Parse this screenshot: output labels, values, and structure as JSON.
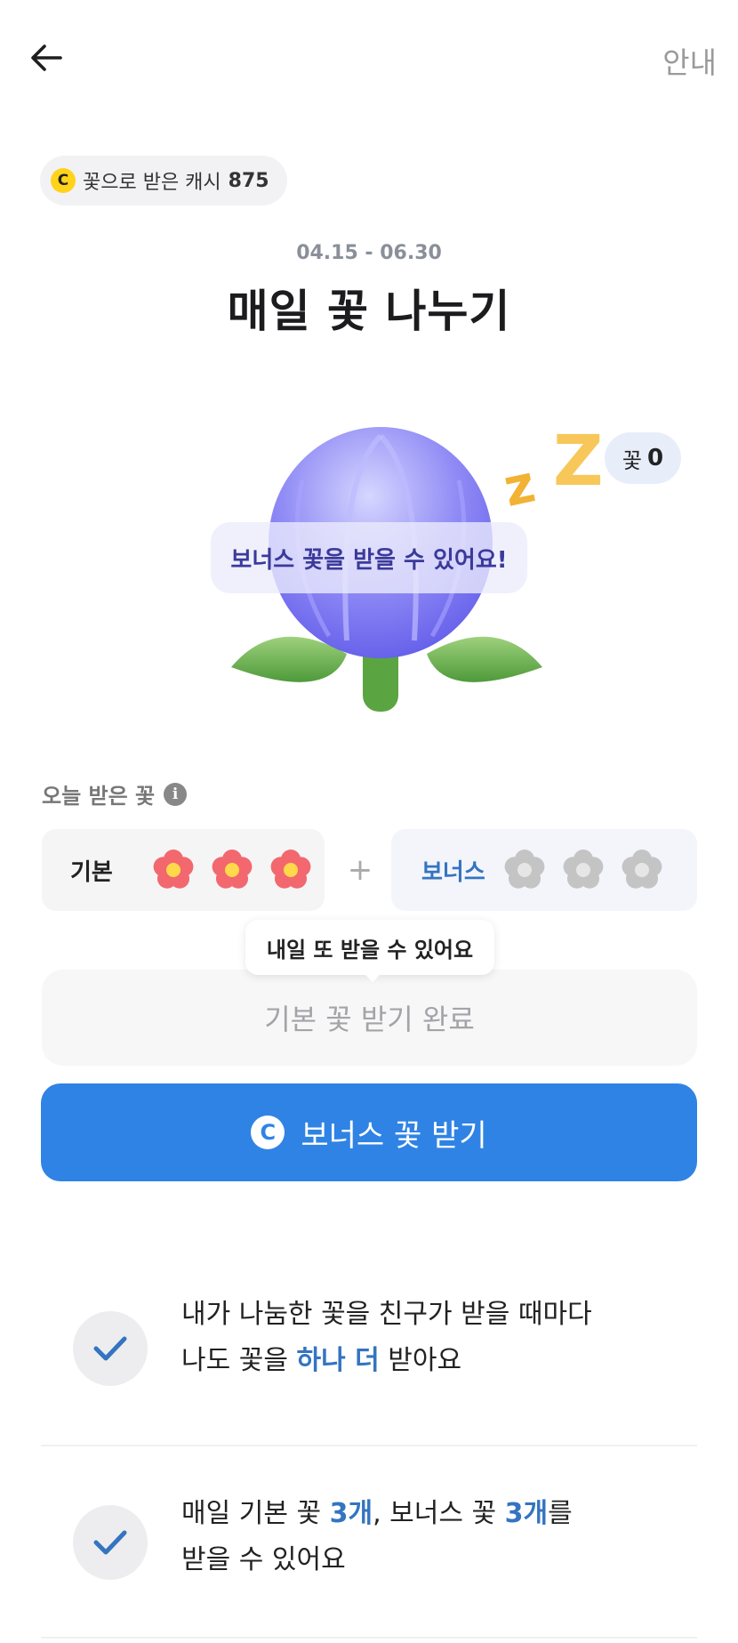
{
  "header": {
    "back_icon": "arrow-left-icon",
    "guide_label": "안내"
  },
  "cash": {
    "coin_symbol": "C",
    "label": "꽃으로 받은 캐시",
    "amount": "875"
  },
  "event": {
    "period": "04.15 - 06.30",
    "title": "매일 꽃 나누기"
  },
  "illustration": {
    "flower_count_label": "꽃",
    "flower_count": "0",
    "bonus_message": "보너스 꽃을 받을 수 있어요!",
    "sleep_icon": "zz-icon"
  },
  "today": {
    "label": "오늘 받은 꽃",
    "info_symbol": "i",
    "basic_label": "기본",
    "basic_filled": 3,
    "plus": "+",
    "bonus_label": "보너스",
    "bonus_filled": 0,
    "colors": {
      "filled": "#f2686e",
      "empty": "#c4c4c4",
      "accent": "#3474c0"
    }
  },
  "tooltip": "내일 또 받을 수 있어요",
  "done_button": "기본 꽃 받기 완료",
  "cta": {
    "coin_symbol": "C",
    "label": "보너스 꽃 받기",
    "color": "#2f83e4"
  },
  "benefits": [
    {
      "line1": "내가 나눔한 꽃을 친구가 받을 때마다",
      "line2_pre": "나도 꽃을 ",
      "line2_hl": "하나 더",
      "line2_post": " 받아요"
    },
    {
      "line1_a": "매일 기본 꽃 ",
      "line1_b": "3개",
      "line1_c": ", 보너스 꽃 ",
      "line1_d": "3개",
      "line1_e": "를",
      "line2": "받을 수 있어요"
    }
  ]
}
